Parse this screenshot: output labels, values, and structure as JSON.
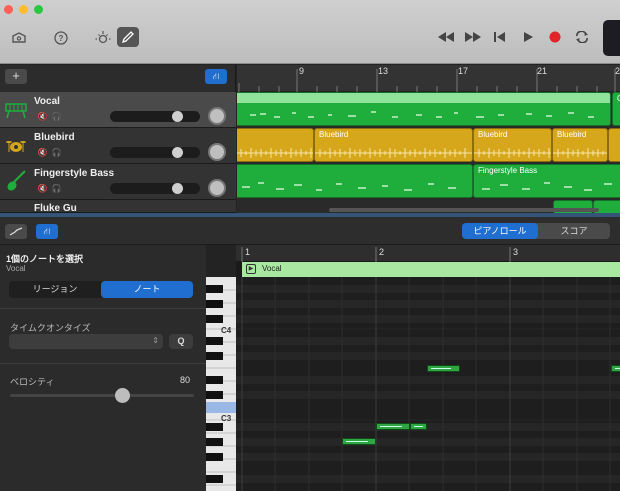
{
  "toolbar": {
    "icons": [
      "library-icon",
      "help-icon",
      "smart-controls-icon",
      "editors-icon"
    ],
    "transport": [
      "rewind-icon",
      "fast-forward-icon",
      "to-start-icon",
      "play-icon",
      "record-icon",
      "cycle-icon"
    ]
  },
  "tracks": [
    {
      "name": "Vocal",
      "color": "#1fae3c",
      "selected": true,
      "volume": 0.75
    },
    {
      "name": "Bluebird",
      "color": "#d6a71a",
      "selected": false,
      "volume": 0.75
    },
    {
      "name": "Fingerstyle Bass",
      "color": "#1fae3c",
      "selected": false,
      "volume": 0.75
    },
    {
      "name": "Fluke Gu",
      "color": "#1fae3c",
      "selected": false,
      "volume": 0.75
    }
  ],
  "ruler": {
    "bars": [
      "9",
      "13",
      "17",
      "21",
      "2"
    ]
  },
  "regions": {
    "bluebird_labels": [
      "Bluebird",
      "Bluebird",
      "Bluebird"
    ],
    "bass_label": "Fingerstyle Bass",
    "vocal_edge_label": "C"
  },
  "editor": {
    "tabs": {
      "piano_roll": "ピアノロール",
      "score": "スコア"
    },
    "selection_title": "1個のノートを選択",
    "selection_subtitle": "Vocal",
    "segment": {
      "region": "リージョン",
      "note": "ノート"
    },
    "time_quantize_label": "タイムクオンタイズ",
    "quantize_button": "Q",
    "velocity_label": "ベロシティ",
    "velocity_value": "80",
    "velocity_fraction": 0.63
  },
  "piano_roll": {
    "bars": [
      "1",
      "2",
      "3"
    ],
    "region_name": "Vocal",
    "key_labels": {
      "c4": "C4",
      "c3": "C3"
    }
  }
}
